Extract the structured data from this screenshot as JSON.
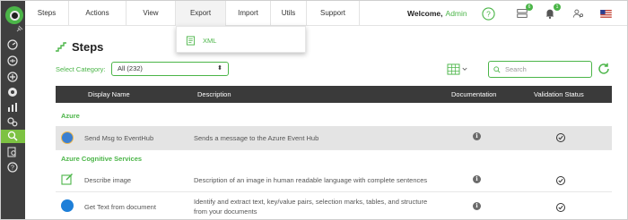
{
  "nav": {
    "items": [
      {
        "label": "Steps"
      },
      {
        "label": "Actions"
      },
      {
        "label": "View"
      },
      {
        "label": "Export"
      },
      {
        "label": "Import"
      },
      {
        "label": "Utils"
      },
      {
        "label": "Support"
      }
    ],
    "welcome_label": "Welcome,",
    "user_name": "Admin",
    "storage_badge": "6",
    "notifications_badge": "1"
  },
  "export_menu": {
    "items": [
      {
        "label": "XML",
        "icon": "xml-file-icon"
      }
    ]
  },
  "page": {
    "title": "Steps",
    "category_label": "Select Category:",
    "category_value": "All (232)",
    "search_placeholder": "Search"
  },
  "table": {
    "headers": [
      "Display Name",
      "Description",
      "Documentation",
      "Validation Status"
    ],
    "groups": [
      {
        "name": "Azure",
        "rows": [
          {
            "name": "Send Msg to EventHub",
            "description": "Sends a message to the Azure Event Hub",
            "icon": "eventhub-icon"
          }
        ]
      },
      {
        "name": "Azure Cognitive Services",
        "rows": [
          {
            "name": "Describe image",
            "description": "Description of an image in human readable language with complete sentences",
            "icon": "pencil-square-icon"
          },
          {
            "name": "Get Text from document",
            "description_line1": "Identify and extract text, key/value pairs, selection marks, tables, and structure",
            "description_line2": "from your documents",
            "icon": "form-recognizer-icon"
          }
        ]
      }
    ]
  },
  "colors": {
    "accent": "#4bb548",
    "sidebar": "#3f3f3f",
    "table_header": "#3a3a3a",
    "highlight_row": "#e4e4e4"
  }
}
